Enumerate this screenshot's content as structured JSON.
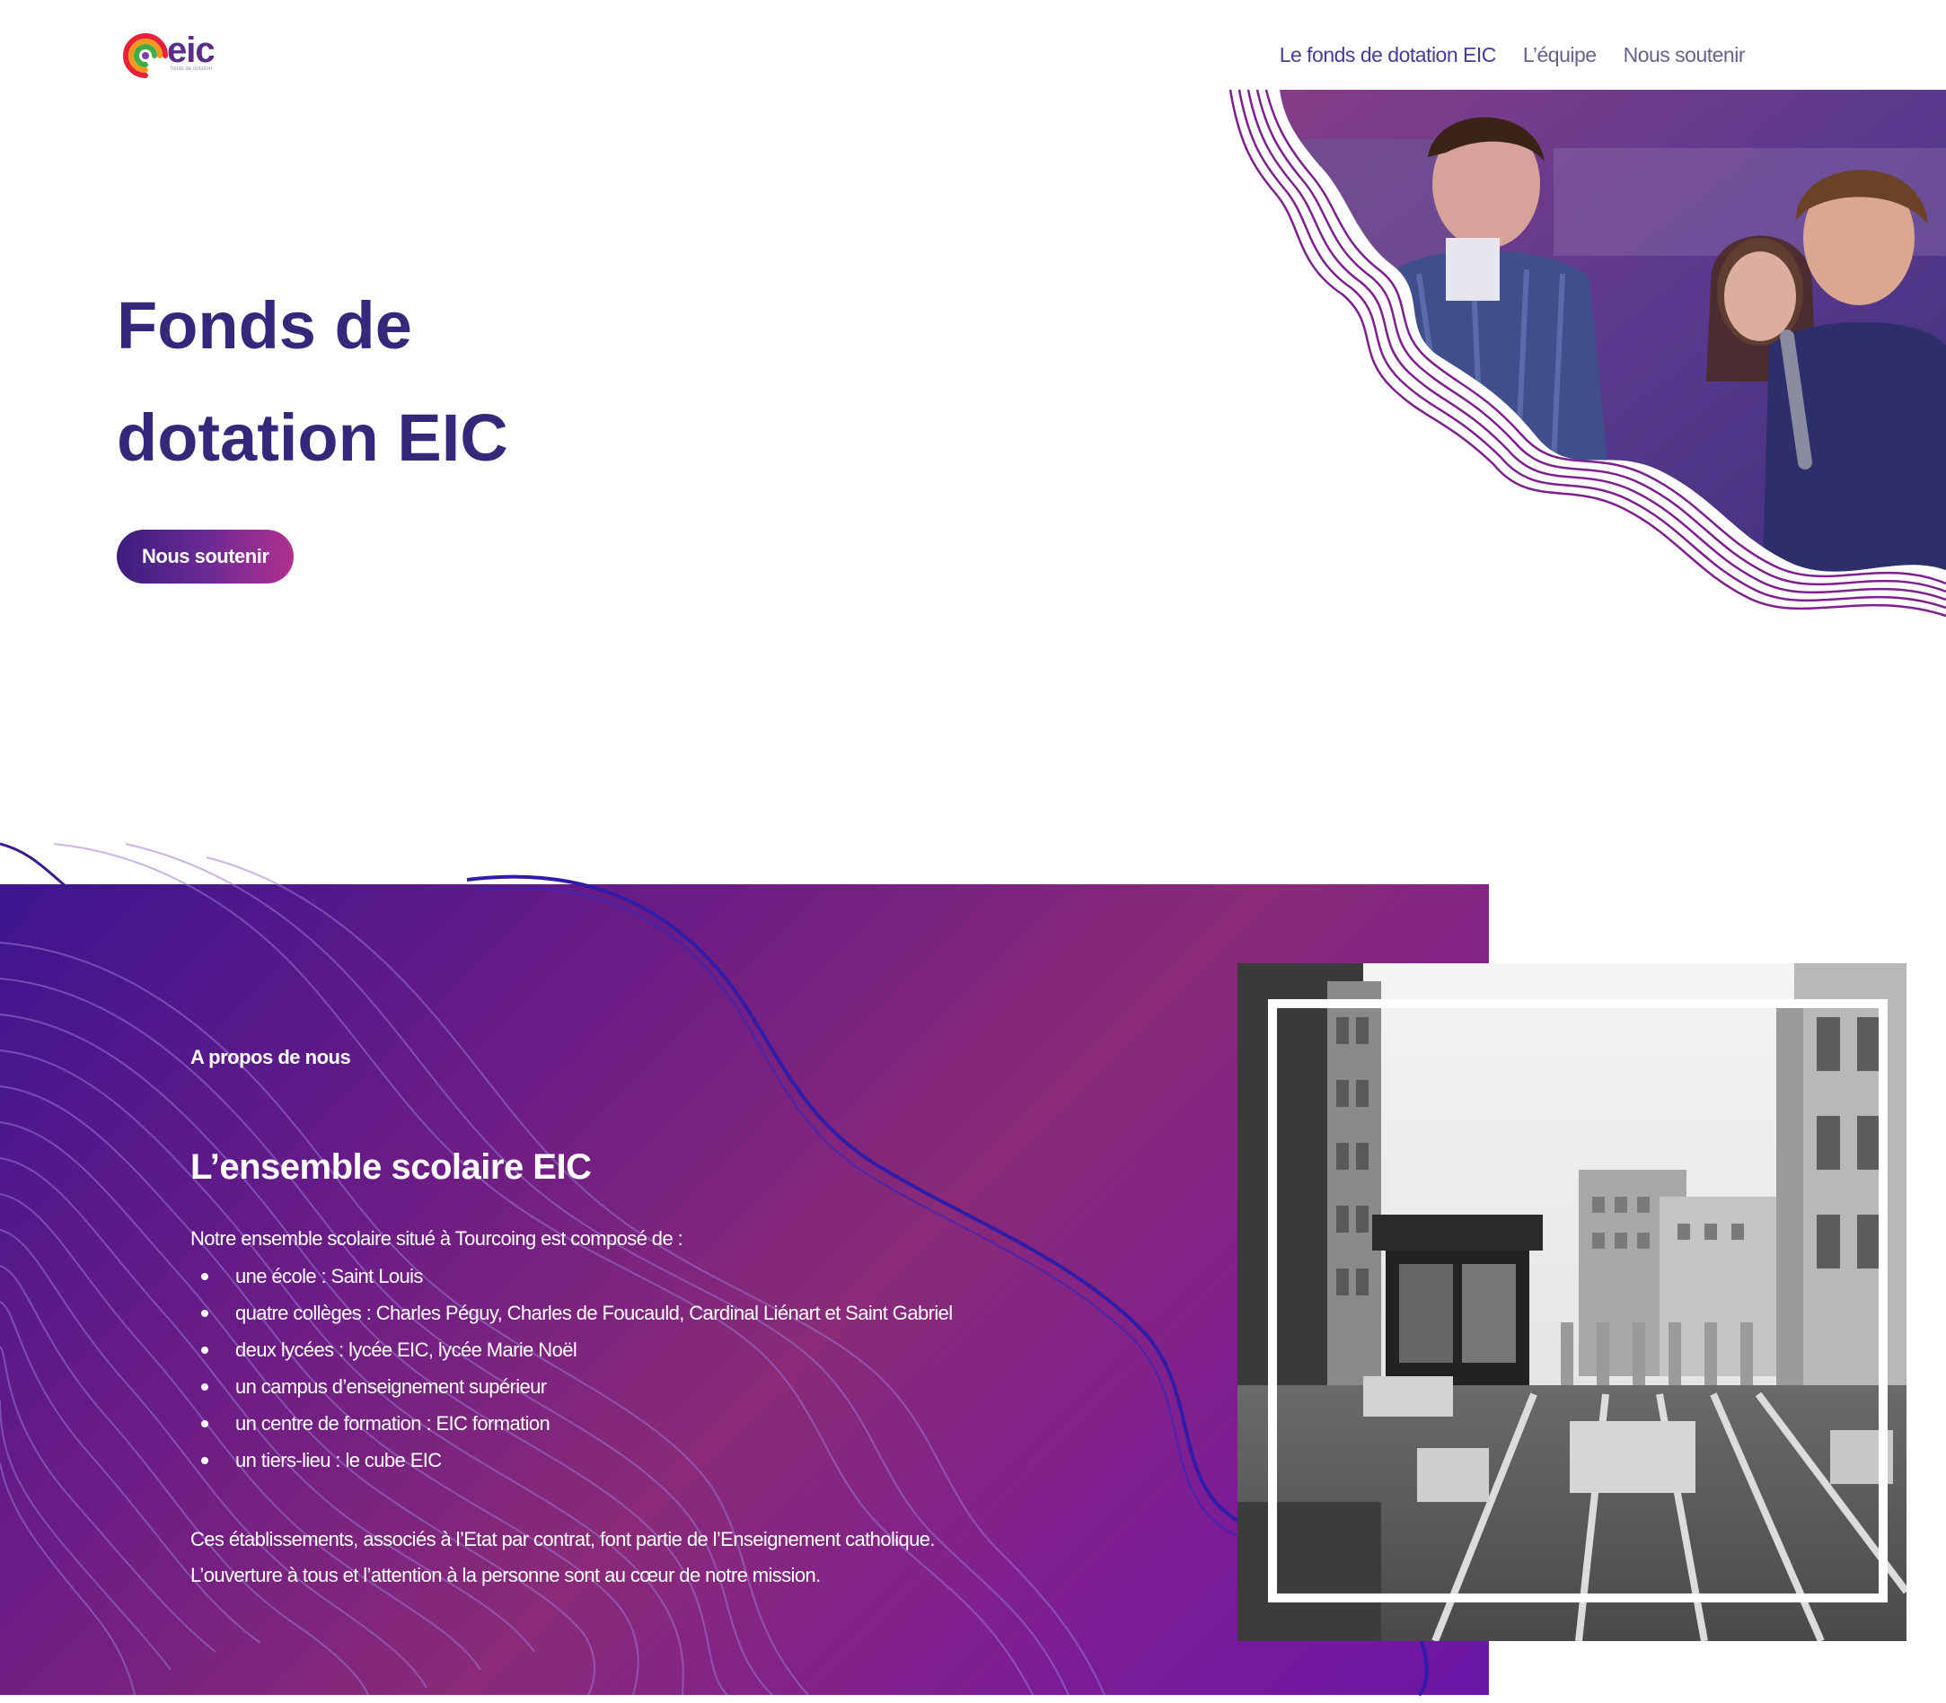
{
  "header": {
    "logo_text": "eic",
    "logo_subtext": "fonds de dotation",
    "nav": [
      {
        "label": "Le fonds de dotation EIC"
      },
      {
        "label": "L’équipe"
      },
      {
        "label": "Nous soutenir"
      }
    ]
  },
  "hero": {
    "title": "Fonds de dotation EIC",
    "cta_label": "Nous soutenir"
  },
  "about": {
    "eyebrow": "A propos de nous",
    "title": "L’ensemble scolaire EIC",
    "intro": "Notre ensemble scolaire situé à Tourcoing est composé de :",
    "items": [
      "une école : Saint Louis",
      "quatre collèges : Charles Péguy, Charles de Foucauld, Cardinal Liénart et Saint Gabriel",
      "deux lycées : lycée EIC, lycée Marie Noël",
      "un campus d’enseignement supérieur",
      "un centre de formation : EIC formation",
      "un tiers-lieu : le cube EIC"
    ],
    "outro_1": "Ces établissements, associés à l’Etat par contrat, font partie de l’Enseignement catholique.",
    "outro_2": "L’ouverture à tous et l’attention à la personne sont au cœur de notre mission."
  },
  "colors": {
    "brand_dark": "#33287a",
    "brand_purple": "#6a1c86",
    "brand_magenta": "#b0308e",
    "band_start": "#3d1590",
    "band_end": "#6b16a8"
  }
}
